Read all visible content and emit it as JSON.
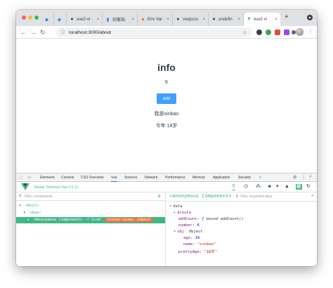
{
  "browser": {
    "tabs": [
      {
        "label": ""
      },
      {
        "label": ""
      },
      {
        "label": "vue2-vi"
      },
      {
        "label": "创客贴"
      },
      {
        "label": "Env Var"
      },
      {
        "label": "vuejs/co"
      },
      {
        "label": "undefin"
      },
      {
        "label": "vue2 vi"
      }
    ],
    "url": "localhost:3000/about"
  },
  "page": {
    "title": "info",
    "count": "6",
    "add_button": "add",
    "line1": "我是xinbao",
    "line2": "今年 18岁"
  },
  "devtools": {
    "tabs": [
      "Elements",
      "Console",
      "CSS Overview",
      "Vue",
      "Sources",
      "Network",
      "Performance",
      "Memory",
      "Application",
      "Security",
      "»"
    ],
    "active_tab": "Vue",
    "ready_text": "Ready. Detected Vue 2.6.12.",
    "left_filter_placeholder": "Filter components",
    "tree": {
      "root": "<Root>",
      "app": "<App>",
      "selected": "<Anonymous Component>",
      "vm": "= $vm0",
      "router_tag": "router-view: /about"
    },
    "component_title": "<Anonymous Component>",
    "right_filter_placeholder": "Filter inspected data",
    "data": {
      "section": "data",
      "route": "$route",
      "addCount_key": "addCount:",
      "addCount_val": "ƒ bound addCount()",
      "number_key": "number:",
      "number_val": "6",
      "obj_key": "obj:",
      "obj_val": "Object",
      "age_key": "age:",
      "age_val": "18",
      "name_key": "name:",
      "name_val": "\"xinbao\"",
      "prettyAge_key": "prettyAge:",
      "prettyAge_val": "\"18岁\""
    }
  },
  "colors": {
    "vue_green": "#41b883",
    "button_blue": "#409eff",
    "router_tag": "#ff7043"
  }
}
